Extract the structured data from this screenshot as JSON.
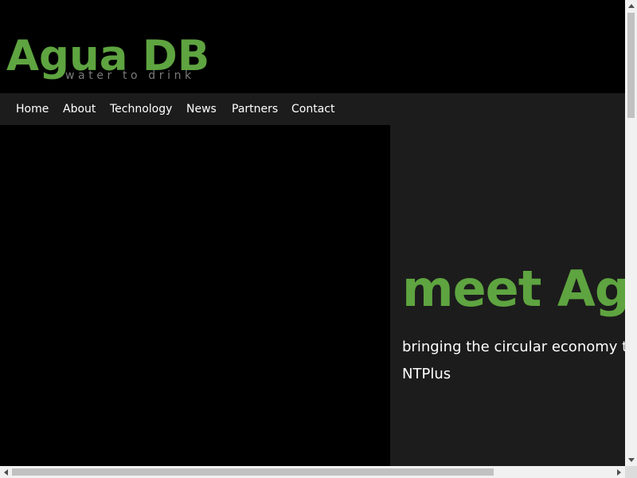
{
  "logo": {
    "title": "Agua DB",
    "tagline": "water to drink"
  },
  "nav": {
    "items": [
      {
        "label": "Home"
      },
      {
        "label": "About"
      },
      {
        "label": "Technology"
      },
      {
        "label": "News"
      },
      {
        "label": "Partners"
      },
      {
        "label": "Contact"
      }
    ]
  },
  "hero": {
    "title": "meet Agua DB",
    "subtitle_line1": "bringing the circular economy to",
    "subtitle_line2": "NTPlus"
  },
  "icons": {
    "scroll_up": "triangle-up-icon",
    "scroll_down": "triangle-down-icon",
    "scroll_left": "triangle-left-icon",
    "scroll_right": "triangle-right-icon"
  },
  "colors": {
    "brand_green": "#5ea440",
    "nav_background": "#1c1c1c",
    "page_background": "#000000",
    "tagline_gray": "#7a7a7a",
    "text_white": "#ffffff"
  }
}
